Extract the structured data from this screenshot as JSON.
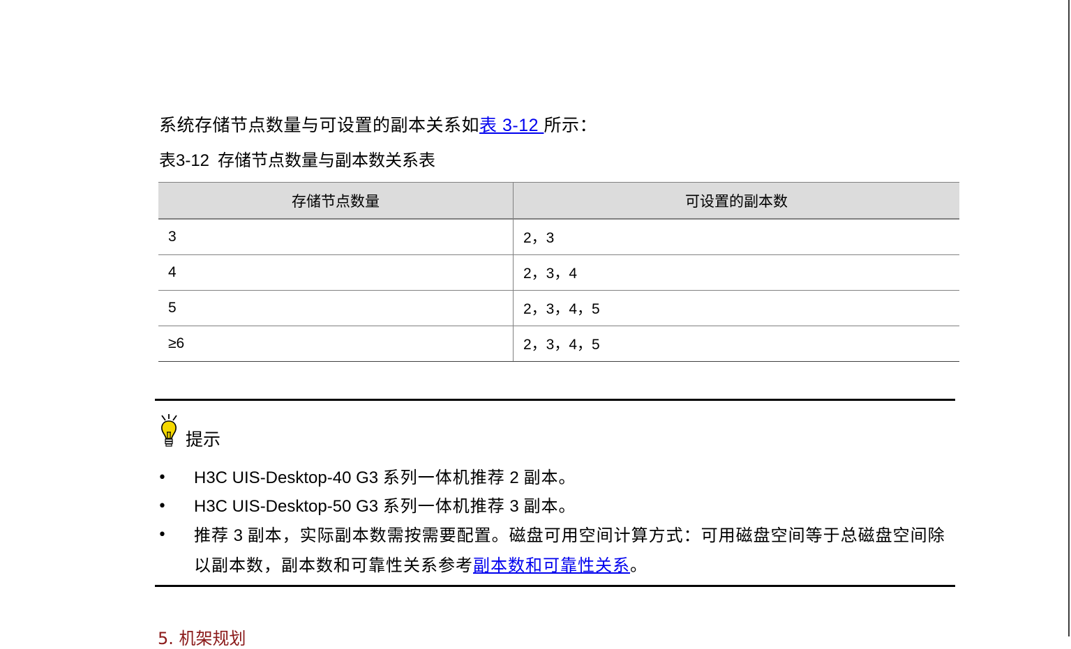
{
  "intro": {
    "text_before": "系统存储节点数量与可设置的副本关系如",
    "link": "表 3-12 ",
    "text_after": "所示："
  },
  "table": {
    "caption_number": "表3-12",
    "caption_title": "存储节点数量与副本数关系表",
    "headers": [
      "存储节点数量",
      "可设置的副本数"
    ],
    "rows": [
      [
        "3",
        "2，3"
      ],
      [
        "4",
        "2，3，4"
      ],
      [
        "5",
        "2，3，4，5"
      ],
      [
        "≥6",
        "2，3，4，5"
      ]
    ]
  },
  "tip": {
    "label": "提示",
    "icon": "lightbulb-icon",
    "items": [
      {
        "latin": "H3C UIS-Desktop-40 G3 ",
        "text": "系列一体机推荐",
        "num": " 2 ",
        "end": "副本。"
      },
      {
        "latin": "H3C UIS-Desktop-50 G3 ",
        "text": "系列一体机推荐",
        "num": " 3 ",
        "end": "副本。"
      }
    ],
    "item3": {
      "text_a": "推荐",
      "num": " 3 ",
      "text_b": "副本，实际副本数需按需要配置。磁盘可用空间计算方式：可用磁盘空间等于总磁盘空间除以副本数，副本数和可靠性关系参考",
      "link": "副本数和可靠性关系",
      "end": "。"
    }
  },
  "next_section": {
    "heading": "5. 机架规划"
  },
  "colors": {
    "link": "#0000ee",
    "header_bg": "#dcdcdc",
    "section_heading": "#8b1a1a"
  }
}
